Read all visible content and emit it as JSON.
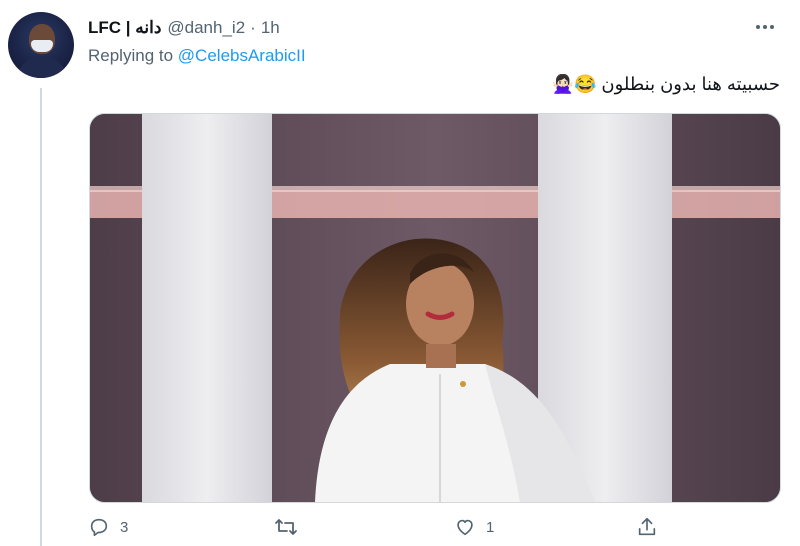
{
  "tweet": {
    "author": {
      "display_name": "LFC | دانه",
      "handle": "@danh_i2",
      "separator": "·",
      "time": "1h"
    },
    "reply": {
      "prefix": "Replying to",
      "mention": "@CelebsArabicII"
    },
    "text": "حسبيته هنا بدون بنطلون 😂🙅🏻‍♀️",
    "stats": {
      "replies": "3",
      "retweets": "",
      "likes": "1"
    }
  },
  "icons": {
    "more": "more-icon",
    "reply": "reply-icon",
    "retweet": "retweet-icon",
    "like": "heart-icon",
    "share": "share-icon"
  },
  "colors": {
    "accent": "#1d9bf0",
    "secondary_text": "#536471",
    "thread_line": "#cfd9de"
  }
}
